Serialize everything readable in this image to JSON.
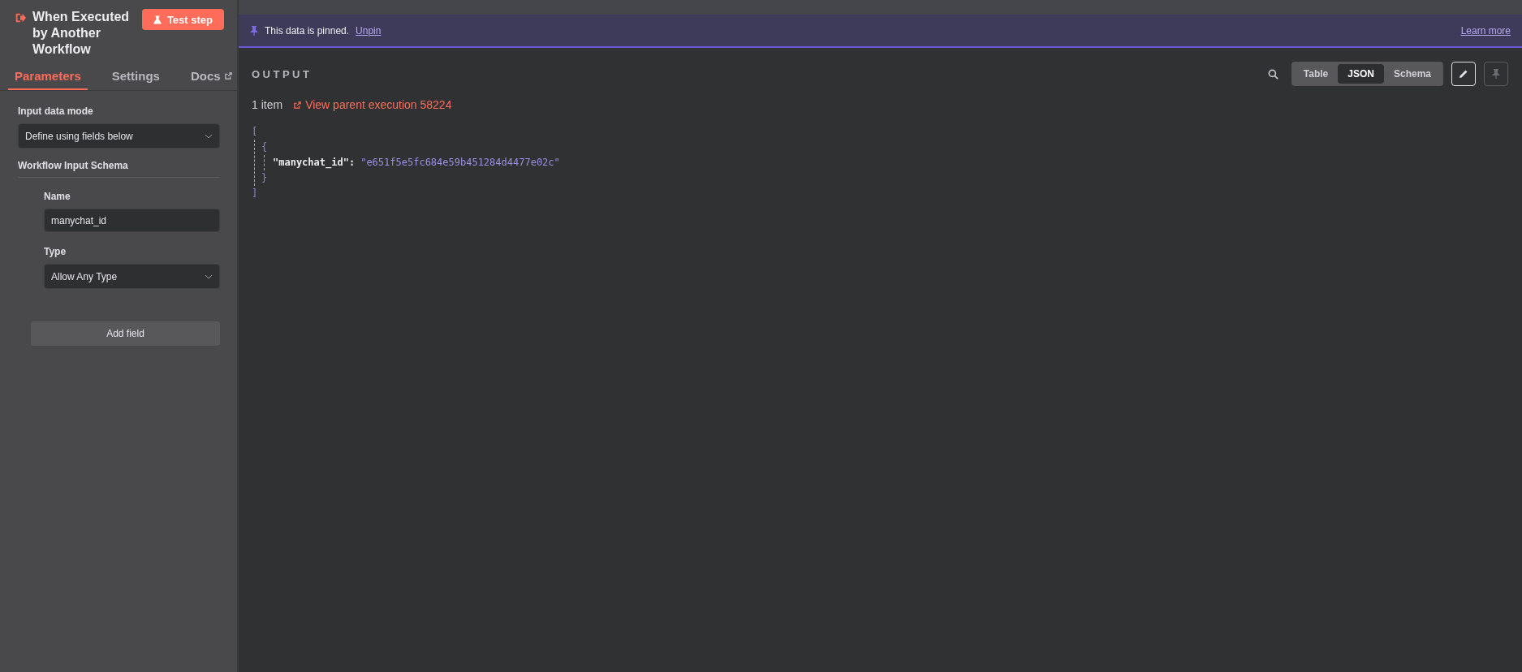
{
  "node": {
    "title": "When Executed by Another Workflow",
    "test_button": "Test step"
  },
  "tabs": [
    {
      "label": "Parameters",
      "selected": true,
      "external": false
    },
    {
      "label": "Settings",
      "selected": false,
      "external": false
    },
    {
      "label": "Docs",
      "selected": false,
      "external": true
    }
  ],
  "parameters": {
    "input_data_mode": {
      "label": "Input data mode",
      "value": "Define using fields below"
    },
    "schema_heading": "Workflow Input Schema",
    "fields": [
      {
        "name_label": "Name",
        "name_value": "manychat_id",
        "type_label": "Type",
        "type_value": "Allow Any Type"
      }
    ],
    "add_field_button": "Add field"
  },
  "banner": {
    "text": "This data is pinned.",
    "unpin": "Unpin",
    "learn_more": "Learn more"
  },
  "output": {
    "heading": "OUTPUT",
    "item_count": "1 item",
    "parent_link": "View parent execution 58224",
    "view_modes": [
      {
        "label": "Table",
        "selected": false
      },
      {
        "label": "JSON",
        "selected": true
      },
      {
        "label": "Schema",
        "selected": false
      }
    ],
    "edit_button": {
      "disabled": false
    },
    "pin_button": {
      "disabled": true
    },
    "json": {
      "open_array": "[",
      "open_object": "{",
      "entries": [
        {
          "key": "\"manychat_id\":",
          "value": "\"e651f5e5fc684e59b451284d4477e02c\""
        }
      ],
      "close_object": "}",
      "close_array": "]"
    }
  }
}
